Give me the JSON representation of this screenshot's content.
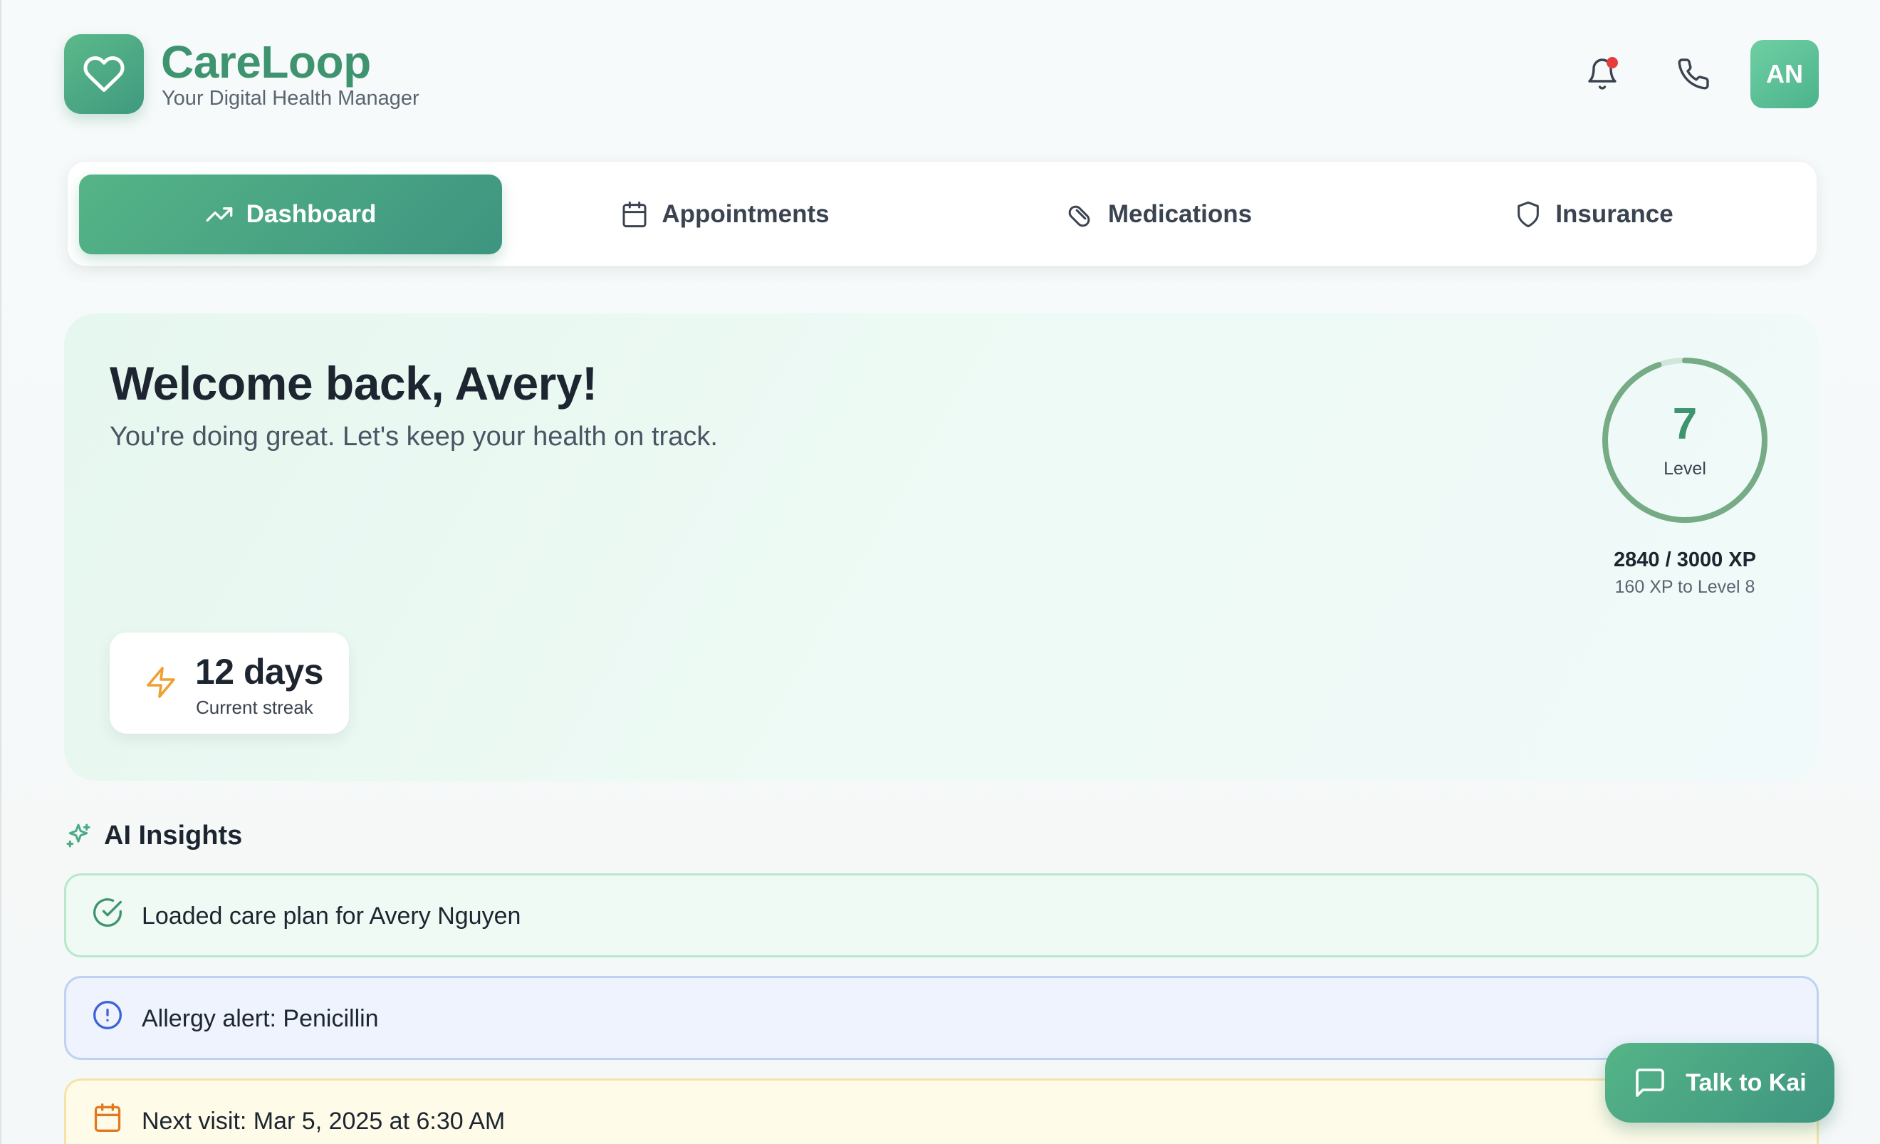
{
  "brand": {
    "name": "CareLoop",
    "tagline": "Your Digital Health Manager",
    "logo_icon": "heart-icon"
  },
  "header": {
    "notifications_icon": "bell-icon",
    "has_unread_notifications": true,
    "call_icon": "phone-icon",
    "avatar_initials": "AN"
  },
  "nav": {
    "tabs": [
      {
        "label": "Dashboard",
        "icon": "trending-up-icon",
        "active": true
      },
      {
        "label": "Appointments",
        "icon": "calendar-icon",
        "active": false
      },
      {
        "label": "Medications",
        "icon": "pill-icon",
        "active": false
      },
      {
        "label": "Insurance",
        "icon": "shield-icon",
        "active": false
      }
    ]
  },
  "welcome": {
    "title": "Welcome back, Avery!",
    "subtitle": "You're doing great. Let's keep your health on track.",
    "streak_value": "12 days",
    "streak_label": "Current streak",
    "level": "7",
    "level_label": "Level",
    "xp_text": "2840 / 3000 XP",
    "xp_next": "160 XP to Level 8",
    "xp_progress": 0.9467
  },
  "ai_insights": {
    "title": "AI Insights",
    "items": [
      {
        "text": "Loaded care plan for Avery Nguyen",
        "icon": "check-circle-icon",
        "tone": "success"
      },
      {
        "text": "Allergy alert: Penicillin",
        "icon": "alert-circle-icon",
        "tone": "info"
      },
      {
        "text": "Next visit: Mar 5, 2025 at 6:30 AM",
        "icon": "calendar-icon",
        "tone": "warning"
      }
    ]
  },
  "chat": {
    "label": "Talk to Kai",
    "icon": "message-square-icon"
  },
  "colors": {
    "primary": "#4caa84",
    "brand_text": "#3f9470",
    "alert_dot": "#e53d3d",
    "streak_icon": "#f0a030",
    "info": "#3d63d6",
    "warning": "#e07a1f"
  }
}
